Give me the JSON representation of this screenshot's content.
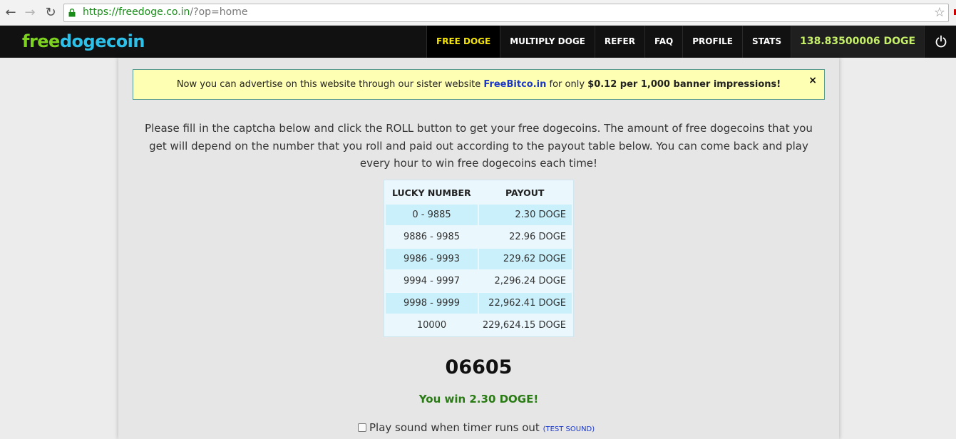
{
  "browser": {
    "url_scheme_host": "https://freedoge.co.in",
    "url_path": "/?op=home"
  },
  "header": {
    "logo_part1": "free",
    "logo_part2": "dogecoin",
    "nav": {
      "free_doge": "FREE DOGE",
      "multiply_doge": "MULTIPLY DOGE",
      "refer": "REFER",
      "faq": "FAQ",
      "profile": "PROFILE",
      "stats": "STATS"
    },
    "balance": "138.83500006 DOGE"
  },
  "notice": {
    "text_before": "Now you can advertise on this website through our sister website ",
    "link_text": "FreeBitco.in",
    "text_middle": " for only ",
    "price_text": "$0.12 per 1,000 banner impressions!",
    "close": "×"
  },
  "intro_text": "Please fill in the captcha below and click the ROLL button to get your free dogecoins. The amount of free dogecoins that you get will depend on the number that you roll and paid out according to the payout table below. You can come back and play every hour to win free dogecoins each time!",
  "payout_table": {
    "headers": [
      "LUCKY NUMBER",
      "PAYOUT"
    ],
    "rows": [
      {
        "range": "0 - 9885",
        "payout": "2.30 DOGE"
      },
      {
        "range": "9886 - 9985",
        "payout": "22.96 DOGE"
      },
      {
        "range": "9986 - 9993",
        "payout": "229.62 DOGE"
      },
      {
        "range": "9994 - 9997",
        "payout": "2,296.24 DOGE"
      },
      {
        "range": "9998 - 9999",
        "payout": "22,962.41 DOGE"
      },
      {
        "range": "10000",
        "payout": "229,624.15 DOGE"
      }
    ]
  },
  "roll_result": "06605",
  "win_message": "You win 2.30 DOGE!",
  "sound": {
    "label": "Play sound when timer runs out",
    "test_link": "(TEST SOUND)"
  },
  "icons": {
    "back": "back-arrow-icon",
    "forward": "forward-arrow-icon",
    "reload": "reload-icon",
    "lock": "lock-icon",
    "star": "star-icon",
    "power": "power-icon"
  },
  "colors": {
    "header_bg": "#111111",
    "active_nav": "#f4e400",
    "balance": "#c6f06a",
    "logo_green": "#7ed321",
    "logo_blue": "#2dc0e8",
    "notice_bg": "#ffffb3",
    "win_green": "#2a7a15",
    "link_blue": "#1a37c8",
    "table_shade": "#c9f0fb"
  }
}
